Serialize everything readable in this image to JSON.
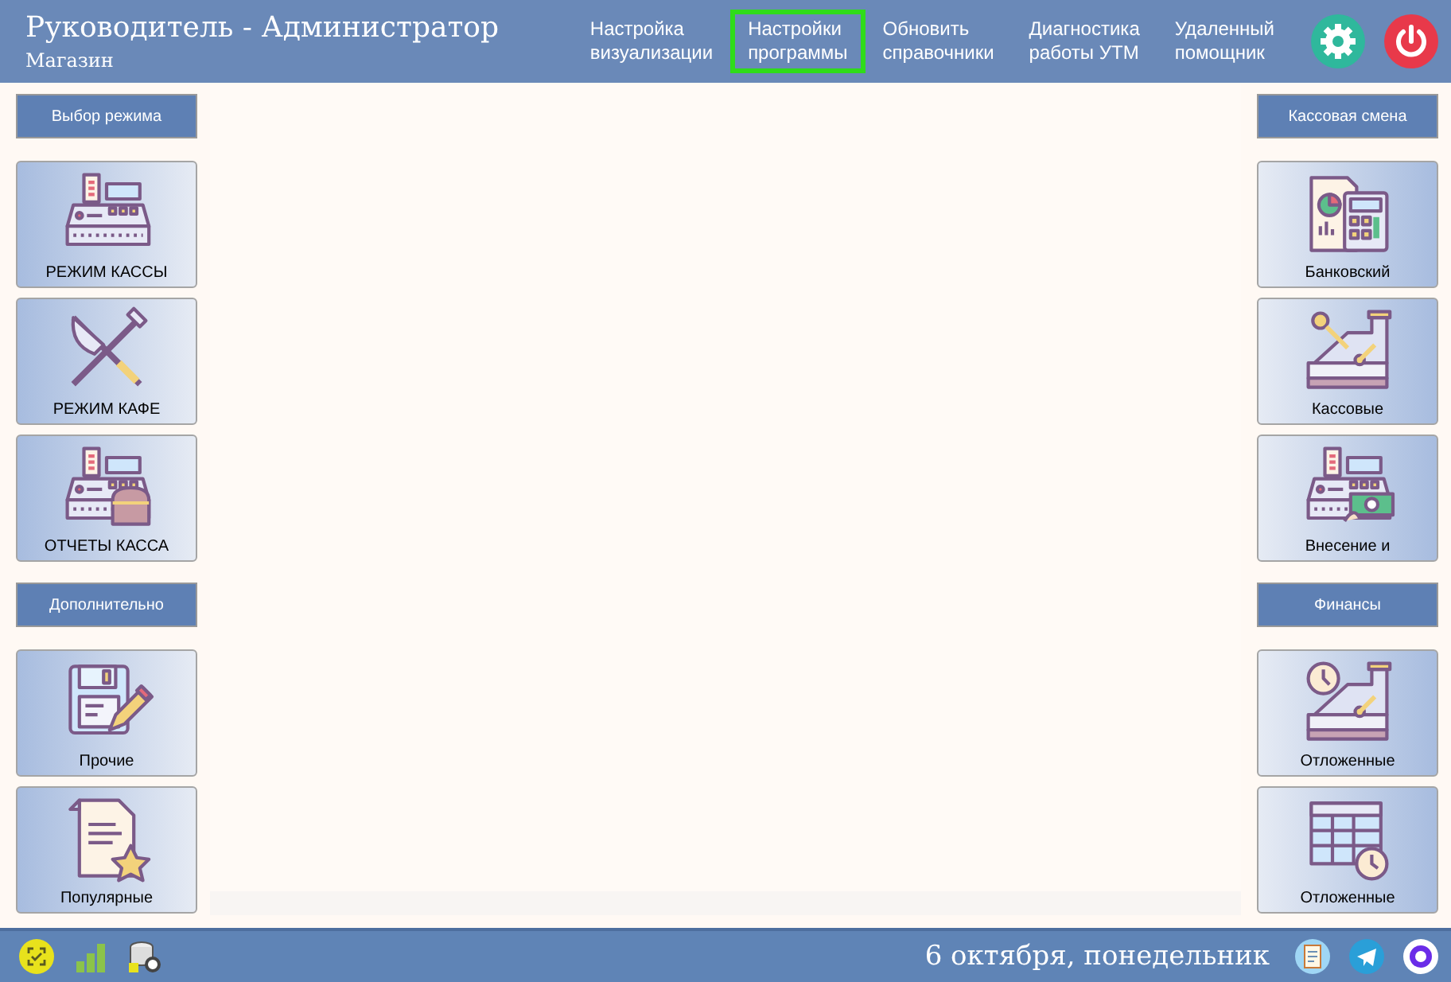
{
  "header": {
    "title": "Руководитель - Администратор",
    "subtitle": "Магазин",
    "menu": [
      {
        "lines": [
          "Настройка",
          "визуализации"
        ],
        "selected": false
      },
      {
        "lines": [
          "Настройки",
          "программы"
        ],
        "selected": true
      },
      {
        "lines": [
          "Обновить",
          "справочники"
        ],
        "selected": false
      },
      {
        "lines": [
          "Диагностика",
          "работы УТМ"
        ],
        "selected": false
      },
      {
        "lines": [
          "Удаленный",
          "помощник"
        ],
        "selected": false
      }
    ]
  },
  "left_sections": [
    {
      "title": "Выбор режима",
      "tiles": [
        {
          "label": "РЕЖИМ КАССЫ"
        },
        {
          "label": "РЕЖИМ КАФЕ"
        },
        {
          "label": "ОТЧЕТЫ КАССА"
        }
      ]
    },
    {
      "title": "Дополнительно",
      "tiles": [
        {
          "label": "Прочие"
        },
        {
          "label": "Популярные"
        }
      ]
    }
  ],
  "right_sections": [
    {
      "title": "Кассовая смена",
      "tiles": [
        {
          "label": "Банковский"
        },
        {
          "label": "Кассовые"
        },
        {
          "label": "Внесение и"
        }
      ]
    },
    {
      "title": "Финансы",
      "tiles": [
        {
          "label": "Отложенные"
        },
        {
          "label": "Отложенные"
        }
      ]
    }
  ],
  "status_bar": {
    "date": "6 октября, понедельник"
  }
}
